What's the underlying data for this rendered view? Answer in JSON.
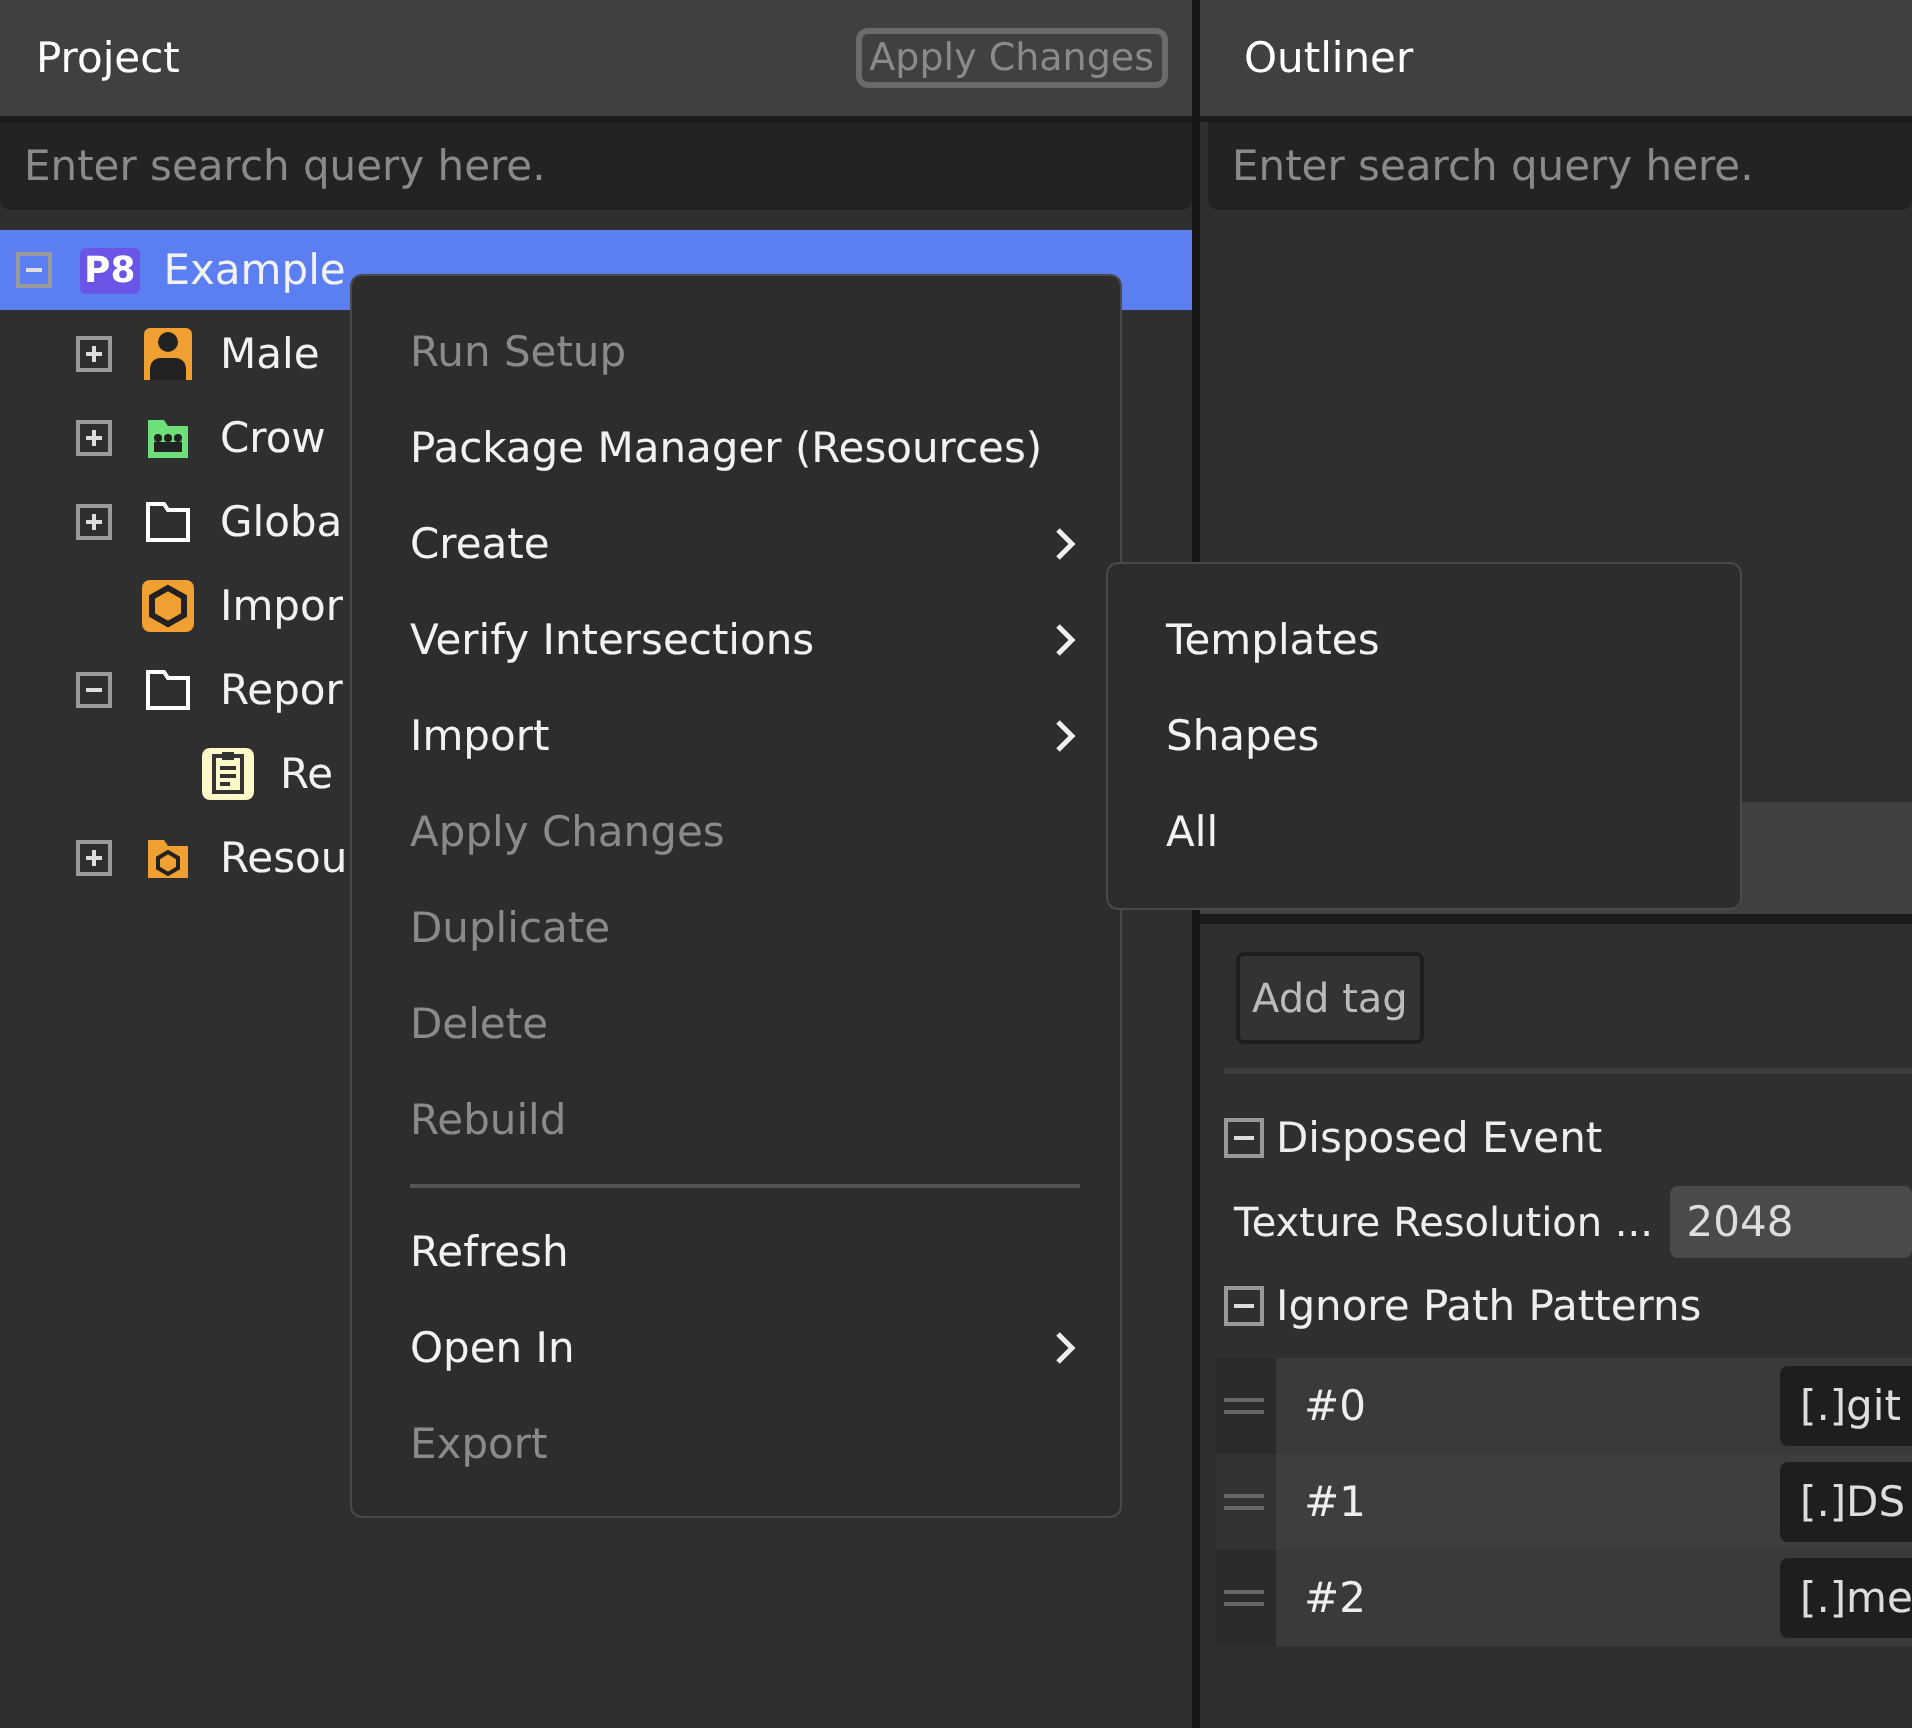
{
  "project_panel": {
    "title": "Project",
    "apply_button": {
      "label": "Apply Changes",
      "disabled": true
    },
    "search": {
      "placeholder": "Enter search query here."
    },
    "tree": [
      {
        "label": "Example",
        "kind": "project",
        "badge": "P8",
        "selected": true,
        "expanded": true,
        "children": [
          {
            "label": "Male",
            "kind": "person",
            "selected": false,
            "expanded": false
          },
          {
            "label": "Crow",
            "kind": "crowd",
            "selected": false,
            "expanded": false
          },
          {
            "label": "Globa",
            "kind": "folder",
            "selected": false,
            "expanded": false
          },
          {
            "label": "Impor",
            "kind": "package",
            "selected": false
          },
          {
            "label": "Repor",
            "kind": "folder",
            "selected": false,
            "expanded": true,
            "children": [
              {
                "label": "Re",
                "kind": "report",
                "selected": false
              }
            ]
          },
          {
            "label": "Resou",
            "kind": "resource-folder",
            "selected": false,
            "expanded": false
          }
        ]
      }
    ]
  },
  "outliner_panel": {
    "title": "Outliner",
    "search": {
      "placeholder": "Enter search query here."
    }
  },
  "inspector": {
    "add_tag_button": "Add tag",
    "sections": [
      {
        "label": "Disposed Event",
        "expanded": true
      },
      {
        "label": "Ignore Path Patterns",
        "expanded": true
      }
    ],
    "texture_resolution": {
      "label": "Texture Resolution ...",
      "value": "2048"
    },
    "patterns": [
      {
        "index": "#0",
        "value": "[.]git"
      },
      {
        "index": "#1",
        "value": "[.]DS"
      },
      {
        "index": "#2",
        "value": "[.]me"
      }
    ]
  },
  "context_menu": {
    "items": [
      {
        "label": "Run Setup",
        "kind": "item",
        "disabled": true,
        "submenu": false
      },
      {
        "label": "Package Manager (Resources)",
        "kind": "item",
        "disabled": false,
        "submenu": false
      },
      {
        "label": "Create",
        "kind": "item",
        "disabled": false,
        "submenu": true
      },
      {
        "label": "Verify Intersections",
        "kind": "item",
        "disabled": false,
        "submenu": true
      },
      {
        "label": "Import",
        "kind": "item",
        "disabled": false,
        "submenu": true
      },
      {
        "label": "Apply Changes",
        "kind": "item",
        "disabled": true,
        "submenu": false
      },
      {
        "label": "Duplicate",
        "kind": "item",
        "disabled": true,
        "submenu": false
      },
      {
        "label": "Delete",
        "kind": "item",
        "disabled": true,
        "submenu": false
      },
      {
        "label": "Rebuild",
        "kind": "item",
        "disabled": true,
        "submenu": false
      },
      {
        "kind": "separator"
      },
      {
        "label": "Refresh",
        "kind": "item",
        "disabled": false,
        "submenu": false
      },
      {
        "label": "Open In",
        "kind": "item",
        "disabled": false,
        "submenu": true
      },
      {
        "label": "Export",
        "kind": "item",
        "disabled": true,
        "submenu": false
      }
    ]
  },
  "submenu": {
    "items": [
      {
        "label": "Templates"
      },
      {
        "label": "Shapes"
      },
      {
        "label": "All"
      }
    ]
  }
}
